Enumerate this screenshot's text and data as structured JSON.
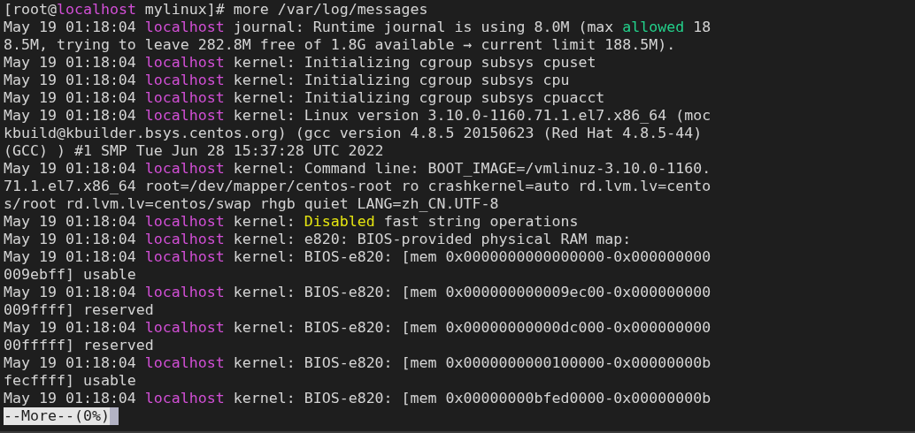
{
  "terminal": {
    "lines": [
      {
        "segments": [
          {
            "text": "[root@",
            "kind": "plain"
          },
          {
            "text": "localhost",
            "kind": "host"
          },
          {
            "text": " mylinux]# more /var/log/messages",
            "kind": "plain"
          }
        ]
      },
      {
        "segments": [
          {
            "text": "May 19 01:18:04 ",
            "kind": "plain"
          },
          {
            "text": "localhost",
            "kind": "host"
          },
          {
            "text": " journal: Runtime journal is using 8.0M (max ",
            "kind": "plain"
          },
          {
            "text": "allowed",
            "kind": "good"
          },
          {
            "text": " 18",
            "kind": "plain"
          }
        ]
      },
      {
        "segments": [
          {
            "text": "8.5M, trying to leave 282.8M free of 1.8G available → current limit 188.5M).",
            "kind": "plain"
          }
        ]
      },
      {
        "segments": [
          {
            "text": "May 19 01:18:04 ",
            "kind": "plain"
          },
          {
            "text": "localhost",
            "kind": "host"
          },
          {
            "text": " kernel: Initializing cgroup subsys cpuset",
            "kind": "plain"
          }
        ]
      },
      {
        "segments": [
          {
            "text": "May 19 01:18:04 ",
            "kind": "plain"
          },
          {
            "text": "localhost",
            "kind": "host"
          },
          {
            "text": " kernel: Initializing cgroup subsys cpu",
            "kind": "plain"
          }
        ]
      },
      {
        "segments": [
          {
            "text": "May 19 01:18:04 ",
            "kind": "plain"
          },
          {
            "text": "localhost",
            "kind": "host"
          },
          {
            "text": " kernel: Initializing cgroup subsys cpuacct",
            "kind": "plain"
          }
        ]
      },
      {
        "segments": [
          {
            "text": "May 19 01:18:04 ",
            "kind": "plain"
          },
          {
            "text": "localhost",
            "kind": "host"
          },
          {
            "text": " kernel: Linux version 3.10.0-1160.71.1.el7.x86_64 (moc",
            "kind": "plain"
          }
        ]
      },
      {
        "segments": [
          {
            "text": "kbuild@kbuilder.bsys.centos.org) (gcc version 4.8.5 20150623 (Red Hat 4.8.5-44)",
            "kind": "plain"
          }
        ]
      },
      {
        "segments": [
          {
            "text": "(GCC) ) #1 SMP Tue Jun 28 15:37:28 UTC 2022",
            "kind": "plain"
          }
        ]
      },
      {
        "segments": [
          {
            "text": "May 19 01:18:04 ",
            "kind": "plain"
          },
          {
            "text": "localhost",
            "kind": "host"
          },
          {
            "text": " kernel: Command line: BOOT_IMAGE=/vmlinuz-3.10.0-1160.",
            "kind": "plain"
          }
        ]
      },
      {
        "segments": [
          {
            "text": "71.1.el7.x86_64 root=/dev/mapper/centos-root ro crashkernel=auto rd.lvm.lv=cento",
            "kind": "plain"
          }
        ]
      },
      {
        "segments": [
          {
            "text": "s/root rd.lvm.lv=centos/swap rhgb quiet LANG=zh_CN.UTF-8",
            "kind": "plain"
          }
        ]
      },
      {
        "segments": [
          {
            "text": "May 19 01:18:04 ",
            "kind": "plain"
          },
          {
            "text": "localhost",
            "kind": "host"
          },
          {
            "text": " kernel: ",
            "kind": "plain"
          },
          {
            "text": "Disabled",
            "kind": "warn"
          },
          {
            "text": " fast string operations",
            "kind": "plain"
          }
        ]
      },
      {
        "segments": [
          {
            "text": "May 19 01:18:04 ",
            "kind": "plain"
          },
          {
            "text": "localhost",
            "kind": "host"
          },
          {
            "text": " kernel: e820: BIOS-provided physical RAM map:",
            "kind": "plain"
          }
        ]
      },
      {
        "segments": [
          {
            "text": "May 19 01:18:04 ",
            "kind": "plain"
          },
          {
            "text": "localhost",
            "kind": "host"
          },
          {
            "text": " kernel: BIOS-e820: [mem 0x0000000000000000-0x000000000",
            "kind": "plain"
          }
        ]
      },
      {
        "segments": [
          {
            "text": "009ebff] usable",
            "kind": "plain"
          }
        ]
      },
      {
        "segments": [
          {
            "text": "May 19 01:18:04 ",
            "kind": "plain"
          },
          {
            "text": "localhost",
            "kind": "host"
          },
          {
            "text": " kernel: BIOS-e820: [mem 0x000000000009ec00-0x000000000",
            "kind": "plain"
          }
        ]
      },
      {
        "segments": [
          {
            "text": "009ffff] reserved",
            "kind": "plain"
          }
        ]
      },
      {
        "segments": [
          {
            "text": "May 19 01:18:04 ",
            "kind": "plain"
          },
          {
            "text": "localhost",
            "kind": "host"
          },
          {
            "text": " kernel: BIOS-e820: [mem 0x00000000000dc000-0x000000000",
            "kind": "plain"
          }
        ]
      },
      {
        "segments": [
          {
            "text": "00fffff] reserved",
            "kind": "plain"
          }
        ]
      },
      {
        "segments": [
          {
            "text": "May 19 01:18:04 ",
            "kind": "plain"
          },
          {
            "text": "localhost",
            "kind": "host"
          },
          {
            "text": " kernel: BIOS-e820: [mem 0x0000000000100000-0x00000000b",
            "kind": "plain"
          }
        ]
      },
      {
        "segments": [
          {
            "text": "fecffff] usable",
            "kind": "plain"
          }
        ]
      },
      {
        "segments": [
          {
            "text": "May 19 01:18:04 ",
            "kind": "plain"
          },
          {
            "text": "localhost",
            "kind": "host"
          },
          {
            "text": " kernel: BIOS-e820: [mem 0x00000000bfed0000-0x00000000b",
            "kind": "plain"
          }
        ]
      }
    ],
    "pager_prompt": "--More--(0%)"
  }
}
